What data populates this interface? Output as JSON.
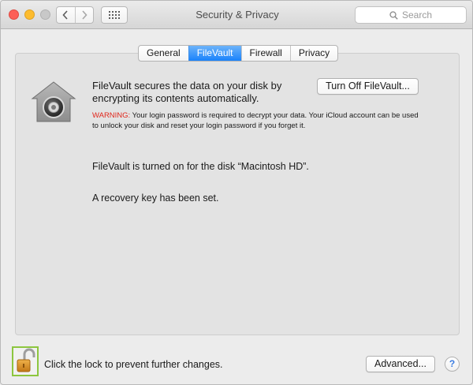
{
  "window": {
    "title": "Security & Privacy"
  },
  "search": {
    "placeholder": "Search"
  },
  "tabs": [
    {
      "label": "General",
      "active": false
    },
    {
      "label": "FileVault",
      "active": true
    },
    {
      "label": "Firewall",
      "active": false
    },
    {
      "label": "Privacy",
      "active": false
    }
  ],
  "filevault": {
    "description": "FileVault secures the data on your disk by encrypting its contents automatically.",
    "turn_off_label": "Turn Off FileVault...",
    "warning_label": "WARNING:",
    "warning_text": " Your login password is required to decrypt your data. Your iCloud account can be used to unlock your disk and reset your login password if you forget it.",
    "status": "FileVault is turned on for the disk “Macintosh HD”.",
    "recovery": "A recovery key has been set."
  },
  "footer": {
    "lock_text": "Click the lock to prevent further changes.",
    "advanced_label": "Advanced...",
    "help_label": "?"
  },
  "colors": {
    "accent": "#1a82fb",
    "warning": "#e0261b",
    "lock_highlight": "#8dc63f"
  },
  "icons": {
    "close": "close-icon",
    "back": "chevron-left-icon",
    "forward": "chevron-right-icon",
    "show_all": "grid-icon",
    "search": "search-icon",
    "filevault": "filevault-house-icon",
    "lock": "padlock-open-icon"
  }
}
